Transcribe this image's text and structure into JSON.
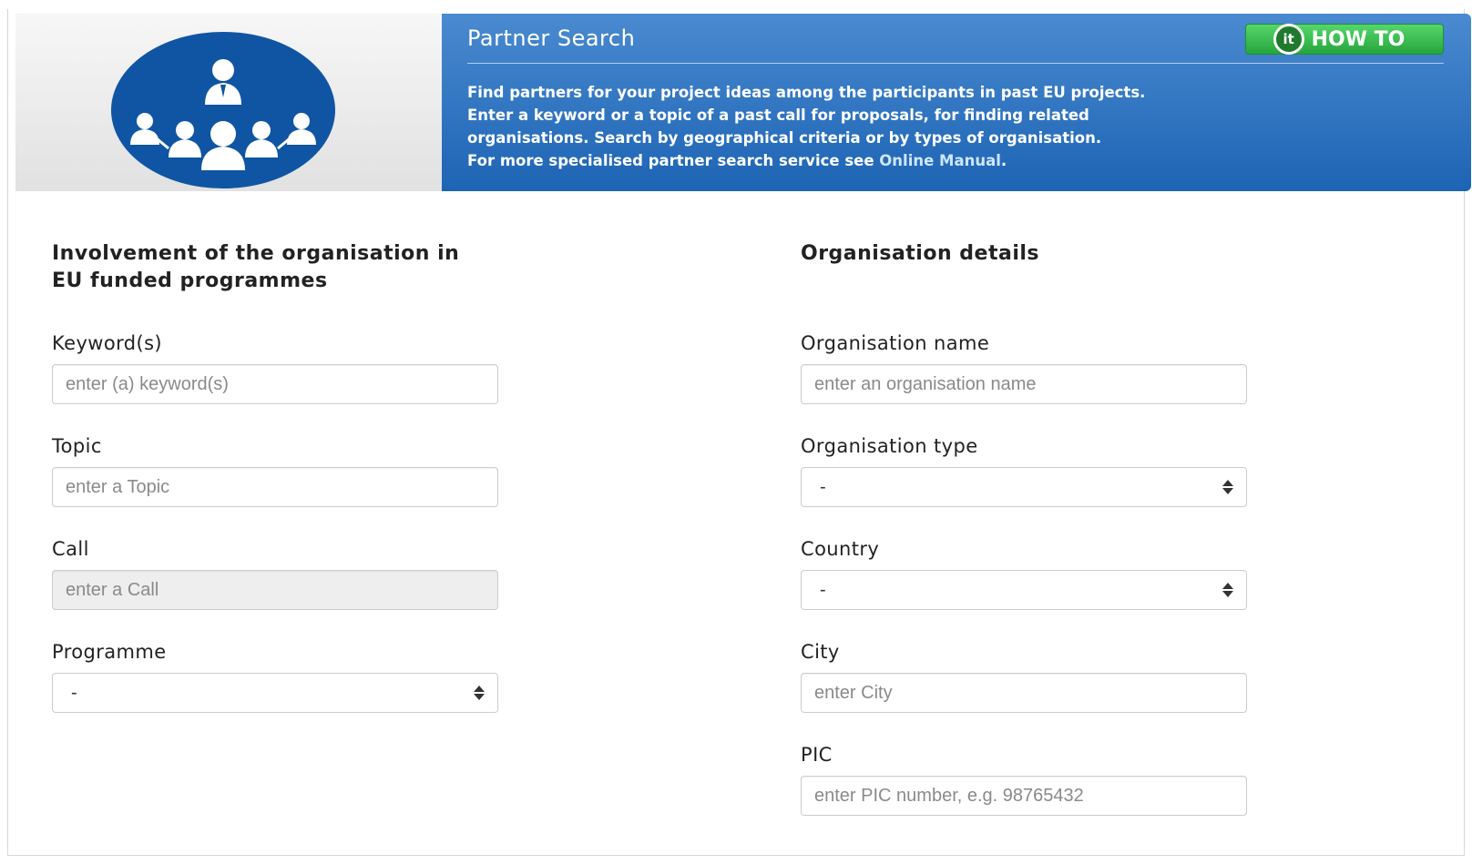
{
  "header": {
    "title": "Partner Search",
    "howto_label": "HOW TO",
    "howto_icon": "it-circle-icon",
    "description_lines": [
      "Find partners for your project ideas among the participants in past EU projects.",
      "Enter a keyword or a topic of a past call for proposals, for finding related",
      "organisations. Search by geographical criteria or by types of organisation."
    ],
    "last_line_prefix": "For more specialised partner search service see ",
    "manual_link": "Online Manual",
    "last_line_suffix": ".",
    "logo_icon": "people-network-icon"
  },
  "left_section": {
    "title_line1": "Involvement of the organisation in",
    "title_line2": "EU funded programmes",
    "keywords": {
      "label": "Keyword(s)",
      "placeholder": "enter (a) keyword(s)"
    },
    "topic": {
      "label": "Topic",
      "placeholder": "enter a Topic"
    },
    "call": {
      "label": "Call",
      "placeholder": "enter a Call"
    },
    "programme": {
      "label": "Programme",
      "value": "-"
    }
  },
  "right_section": {
    "title": "Organisation details",
    "org_name": {
      "label": "Organisation name",
      "placeholder": "enter an organisation name"
    },
    "org_type": {
      "label": "Organisation type",
      "value": "-"
    },
    "country": {
      "label": "Country",
      "value": "-"
    },
    "city": {
      "label": "City",
      "placeholder": "enter City"
    },
    "pic": {
      "label": "PIC",
      "placeholder": "enter PIC number, e.g. 98765432"
    }
  },
  "colors": {
    "header_blue": "#1d64b4",
    "logo_blue": "#0f55a3",
    "howto_green": "#26a53d"
  }
}
